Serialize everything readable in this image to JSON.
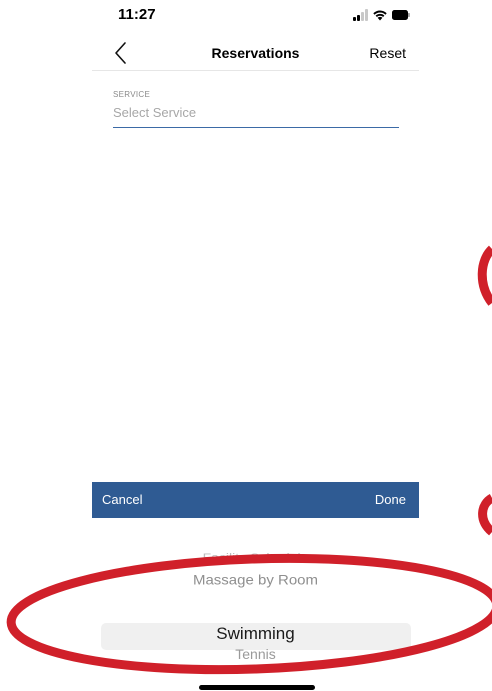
{
  "status_bar": {
    "time": "11:27",
    "signal_icon": "cellular-signal-icon",
    "wifi_icon": "wifi-icon",
    "battery_icon": "battery-icon"
  },
  "nav": {
    "back_icon": "chevron-left-icon",
    "title": "Reservations",
    "reset_label": "Reset"
  },
  "service_field": {
    "label": "SERVICE",
    "placeholder": "Select Service",
    "underline_color": "#3b6aa6"
  },
  "picker_toolbar": {
    "cancel_label": "Cancel",
    "done_label": "Done",
    "background": "#2f5b93"
  },
  "picker": {
    "options": [
      "Facility Schedule",
      "Massage by Room",
      "Swimming",
      "Tennis"
    ],
    "selected": "Swimming"
  },
  "annotation_color": "#d0202a"
}
